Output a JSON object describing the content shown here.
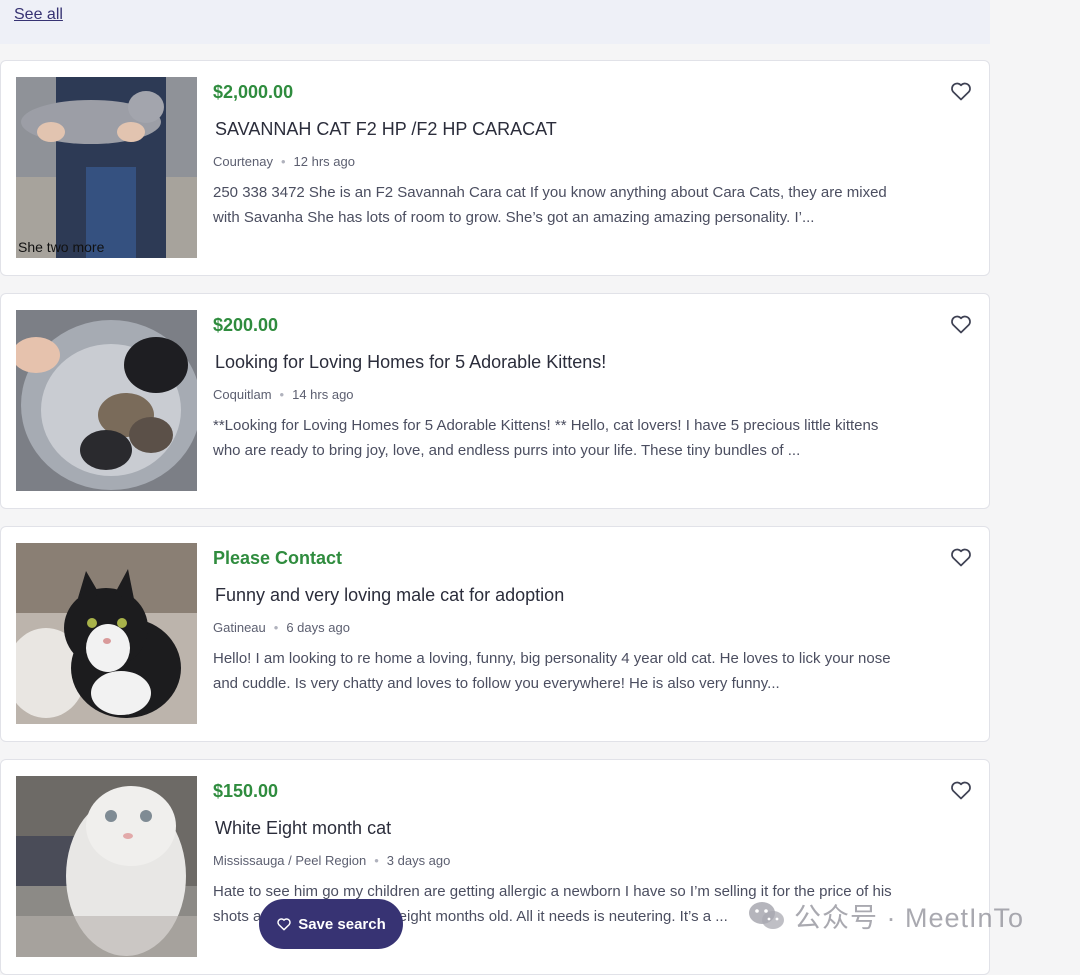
{
  "top": {
    "see_all": "See all"
  },
  "listings": [
    {
      "price": "$2,000.00",
      "title": "SAVANNAH CAT F2 HP /F2 HP CARACAT",
      "location": "Courtenay",
      "time": "12 hrs ago",
      "description": "250 338 3472 She is an F2 Savannah Cara cat If you know anything about Cara Cats, they are mixed with Savanha She has lots of room to grow. She’s got an amazing amazing personality. I’...",
      "image_caption": "She two more"
    },
    {
      "price": "$200.00",
      "title": "Looking for Loving Homes for 5 Adorable Kittens!",
      "location": "Coquitlam",
      "time": "14 hrs ago",
      "description": "**Looking for Loving Homes for 5 Adorable Kittens! ** Hello, cat lovers! I have 5 precious little kittens who are ready to bring joy, love, and endless purrs into your life. These tiny bundles of ..."
    },
    {
      "price": "Please Contact",
      "title": "Funny and very loving male cat for adoption",
      "location": "Gatineau",
      "time": "6 days ago",
      "description": "Hello! I am looking to re home a loving, funny, big personality 4 year old cat. He loves to lick your nose and cuddle. Is very chatty and loves to follow you everywhere! He is also very funny..."
    },
    {
      "price": "$150.00",
      "title": "White Eight month cat",
      "location": "Mississauga / Peel Region",
      "time": "3 days ago",
      "description": "Hate to see him go my children are getting allergic a newborn I have so I’m selling it for the price of his shots and medication that’s eight months old. All it needs is neutering. It’s a ..."
    }
  ],
  "save_search": {
    "label": "Save search"
  },
  "watermark": {
    "text": "公众号 · MeetInTo"
  },
  "colors": {
    "price_green": "#2f8c3e",
    "brand_navy": "#373373"
  },
  "icons": [
    "heart-icon",
    "wechat-icon"
  ]
}
